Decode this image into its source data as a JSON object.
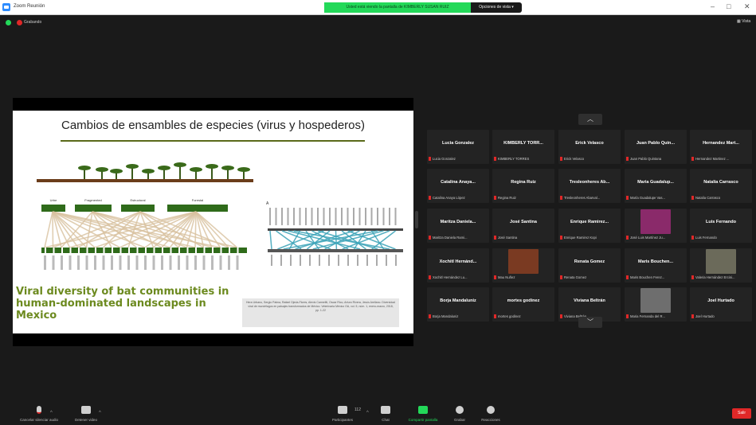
{
  "window": {
    "title": "Zoom Reunión",
    "share_banner": "Usted está viendo la pantalla de KIMBERLY SUSAN RUIZ",
    "view_options": "Opciones de vista ▾"
  },
  "meeting": {
    "recording_label": "Grabando",
    "view_label": "Vista"
  },
  "slide": {
    "title": "Cambios de ensambles de especies (virus y hospederos)",
    "habitats": [
      "Urbe",
      "Fragmented",
      "Estructural",
      "Forestal"
    ],
    "panel_label": "A",
    "viral_title": "Viral diversity of bat communities in human-dominated landscapes in Mexico",
    "citation": "Hera Urbano, Sergio Palma, Rafael Ojeda-Flores, Alexis Carmeliti, Oscar Rico, Arturo Rivera, Jesús Arellano. Diversidad viral de murciélagos en paisajes transformados de México. Veterinaria México OA, vol. 5, núm. 1, enero-marzo, 2018, pp. 1-22",
    "accent_color": "#6c8a1f"
  },
  "participants": [
    {
      "name": "Lucia Gonzalez",
      "footer": "Lucia Gonzalez"
    },
    {
      "name": "KIMBERLY TORR...",
      "footer": "KIMBERLY TORRES"
    },
    {
      "name": "Erick Velasco",
      "footer": "Erick Velasco"
    },
    {
      "name": "Juan Pablo Quin...",
      "footer": "Juan Pablo Quintana"
    },
    {
      "name": "Hernandez Mart...",
      "footer": "Hernandez Martinez ..."
    },
    {
      "name": "Catalina Anaya...",
      "footer": "Catalina Anaya López"
    },
    {
      "name": "Regina Ruiz",
      "footer": "Regina Ruiz"
    },
    {
      "name": "Tresleonheres Ab...",
      "footer": "Tresleonheres Abarval..."
    },
    {
      "name": "Maria Guadalup...",
      "footer": "María Guadalupe Vas..."
    },
    {
      "name": "Natalia Carrasco",
      "footer": "Natalia Carrasco"
    },
    {
      "name": "Maritza Daniela...",
      "footer": "Maritza Daniela Rami..."
    },
    {
      "name": "José Santina",
      "footer": "José Santina"
    },
    {
      "name": "Enrique Ramirez...",
      "footer": "Enrique Ramirez Kopi"
    },
    {
      "name": "",
      "footer": "José Luis Martínez Ju...",
      "photo": "#8a2a6a"
    },
    {
      "name": "Luis Fernando",
      "footer": "Luis Fernando"
    },
    {
      "name": "Xochitl Hernánd...",
      "footer": "Xochitl Hernández Lu..."
    },
    {
      "name": "",
      "footer": "Mau Nuñez",
      "photo": "#7a3a22"
    },
    {
      "name": "Renata Gomez",
      "footer": "Renata Gomez"
    },
    {
      "name": "Maris Bouchen...",
      "footer": "Maris Bouchen Ferez..."
    },
    {
      "name": "",
      "footer": "Valeria Hernández Ercini...",
      "photo": "#6b6a5a"
    },
    {
      "name": "Borja Mandaluniz",
      "footer": "Borja Mandaluniz"
    },
    {
      "name": "mortes godinez",
      "footer": "mortes godinez"
    },
    {
      "name": "Viviana Beltrán",
      "footer": "Viviana Beltrán"
    },
    {
      "name": "",
      "footer": "Maria Fernanda del R...",
      "photo": "#6e6e6e"
    },
    {
      "name": "Joel Hurtado",
      "footer": "Joel Hurtado"
    }
  ],
  "toolbar": {
    "mic_label": "Cancelar silenciar audio",
    "video_label": "Detener video",
    "participants_label": "Participantes",
    "participants_count": "112",
    "chat_label": "Chat",
    "share_label": "Compartir pantalla",
    "record_label": "Grabar",
    "reactions_label": "Reacciones",
    "leave_label": "Salir"
  }
}
